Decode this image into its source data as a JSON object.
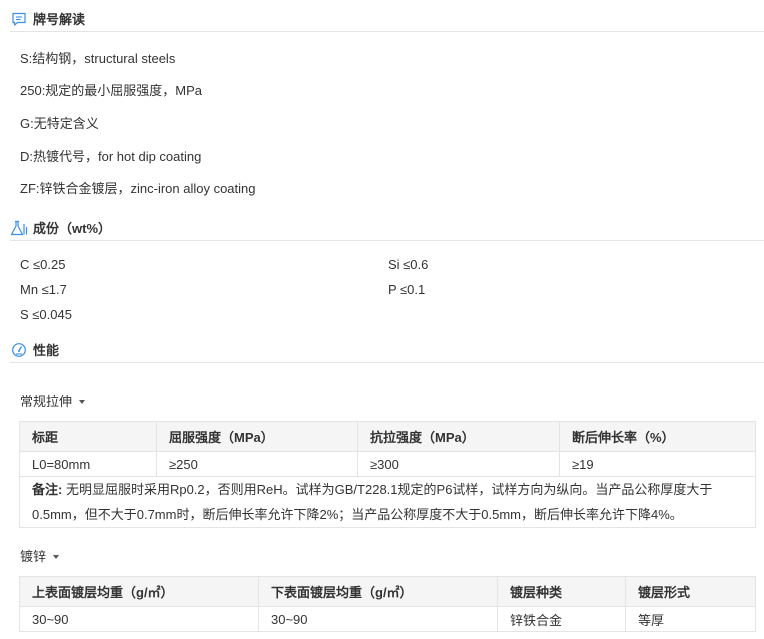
{
  "brand_section": {
    "title": "牌号解读",
    "icon": "message-icon",
    "lines": [
      "S:结构钢，structural steels",
      "250:规定的最小屈服强度，MPa",
      "G:无特定含义",
      "D:热镀代号，for hot dip coating",
      "ZF:锌铁合金镀层，zinc-iron alloy coating"
    ]
  },
  "composition_section": {
    "title": "成份（wt%）",
    "icon": "flask-icon",
    "items": [
      "C ≤0.25",
      "Si ≤0.6",
      "Mn ≤1.7",
      "P ≤0.1",
      "S ≤0.045"
    ]
  },
  "performance_section": {
    "title": "性能",
    "icon": "gauge-icon"
  },
  "tensile": {
    "toggle_label": "常规拉伸",
    "headers": [
      "标距",
      "屈服强度（MPa）",
      "抗拉强度（MPa）",
      "断后伸长率（%）"
    ],
    "row": [
      "L0=80mm",
      "≥250",
      "≥300",
      "≥19"
    ],
    "note_label": "备注:",
    "note_text": " 无明显屈服时采用Rp0.2，否则用ReH。试样为GB/T228.1规定的P6试样，试样方向为纵向。当产品公称厚度大于0.5mm，但不大于0.7mm时，断后伸长率允许下降2%；当产品公称厚度不大于0.5mm，断后伸长率允许下降4%。"
  },
  "coating": {
    "toggle_label": "镀锌",
    "headers": [
      "上表面镀层均重（g/㎡）",
      "下表面镀层均重（g/㎡）",
      "镀层种类",
      "镀层形式"
    ],
    "row": [
      "30~90",
      "30~90",
      "锌铁合金",
      "等厚"
    ]
  },
  "colors": {
    "icon_blue": "#3a8ee6",
    "border": "#e4e4e4",
    "header_bg": "#f5f5f5",
    "text": "#333333"
  }
}
